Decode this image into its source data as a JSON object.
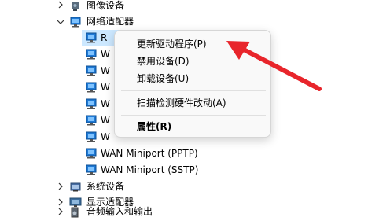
{
  "tree": {
    "image_devices": "图像设备",
    "network_adapters": "网络适配器",
    "adapter_items": [
      "R",
      "W",
      "W",
      "W",
      "W",
      "W",
      "W"
    ],
    "wan_pptp": "WAN Miniport (PPTP)",
    "wan_sstp": "WAN Miniport (SSTP)",
    "system_devices": "系统设备",
    "display_adapters": "显示适配器",
    "audio_io": "音频输入和输出"
  },
  "context_menu": {
    "update_driver": "更新驱动程序(P)",
    "disable_device": "禁用设备(D)",
    "uninstall_device": "卸载设备(U)",
    "scan_hardware": "扫描检测硬件改动(A)",
    "properties": "属性(R)"
  },
  "colors": {
    "selection": "#cce8ff",
    "arrow": "#e8252b",
    "network_icon": "#1f7ad6"
  },
  "icons": {
    "chevron_right": "chevron-right-icon",
    "chevron_down": "chevron-down-icon",
    "network": "network-adapter-icon",
    "camera": "camera-icon",
    "chip": "chip-icon",
    "monitor": "monitor-icon",
    "speaker": "speaker-icon"
  }
}
